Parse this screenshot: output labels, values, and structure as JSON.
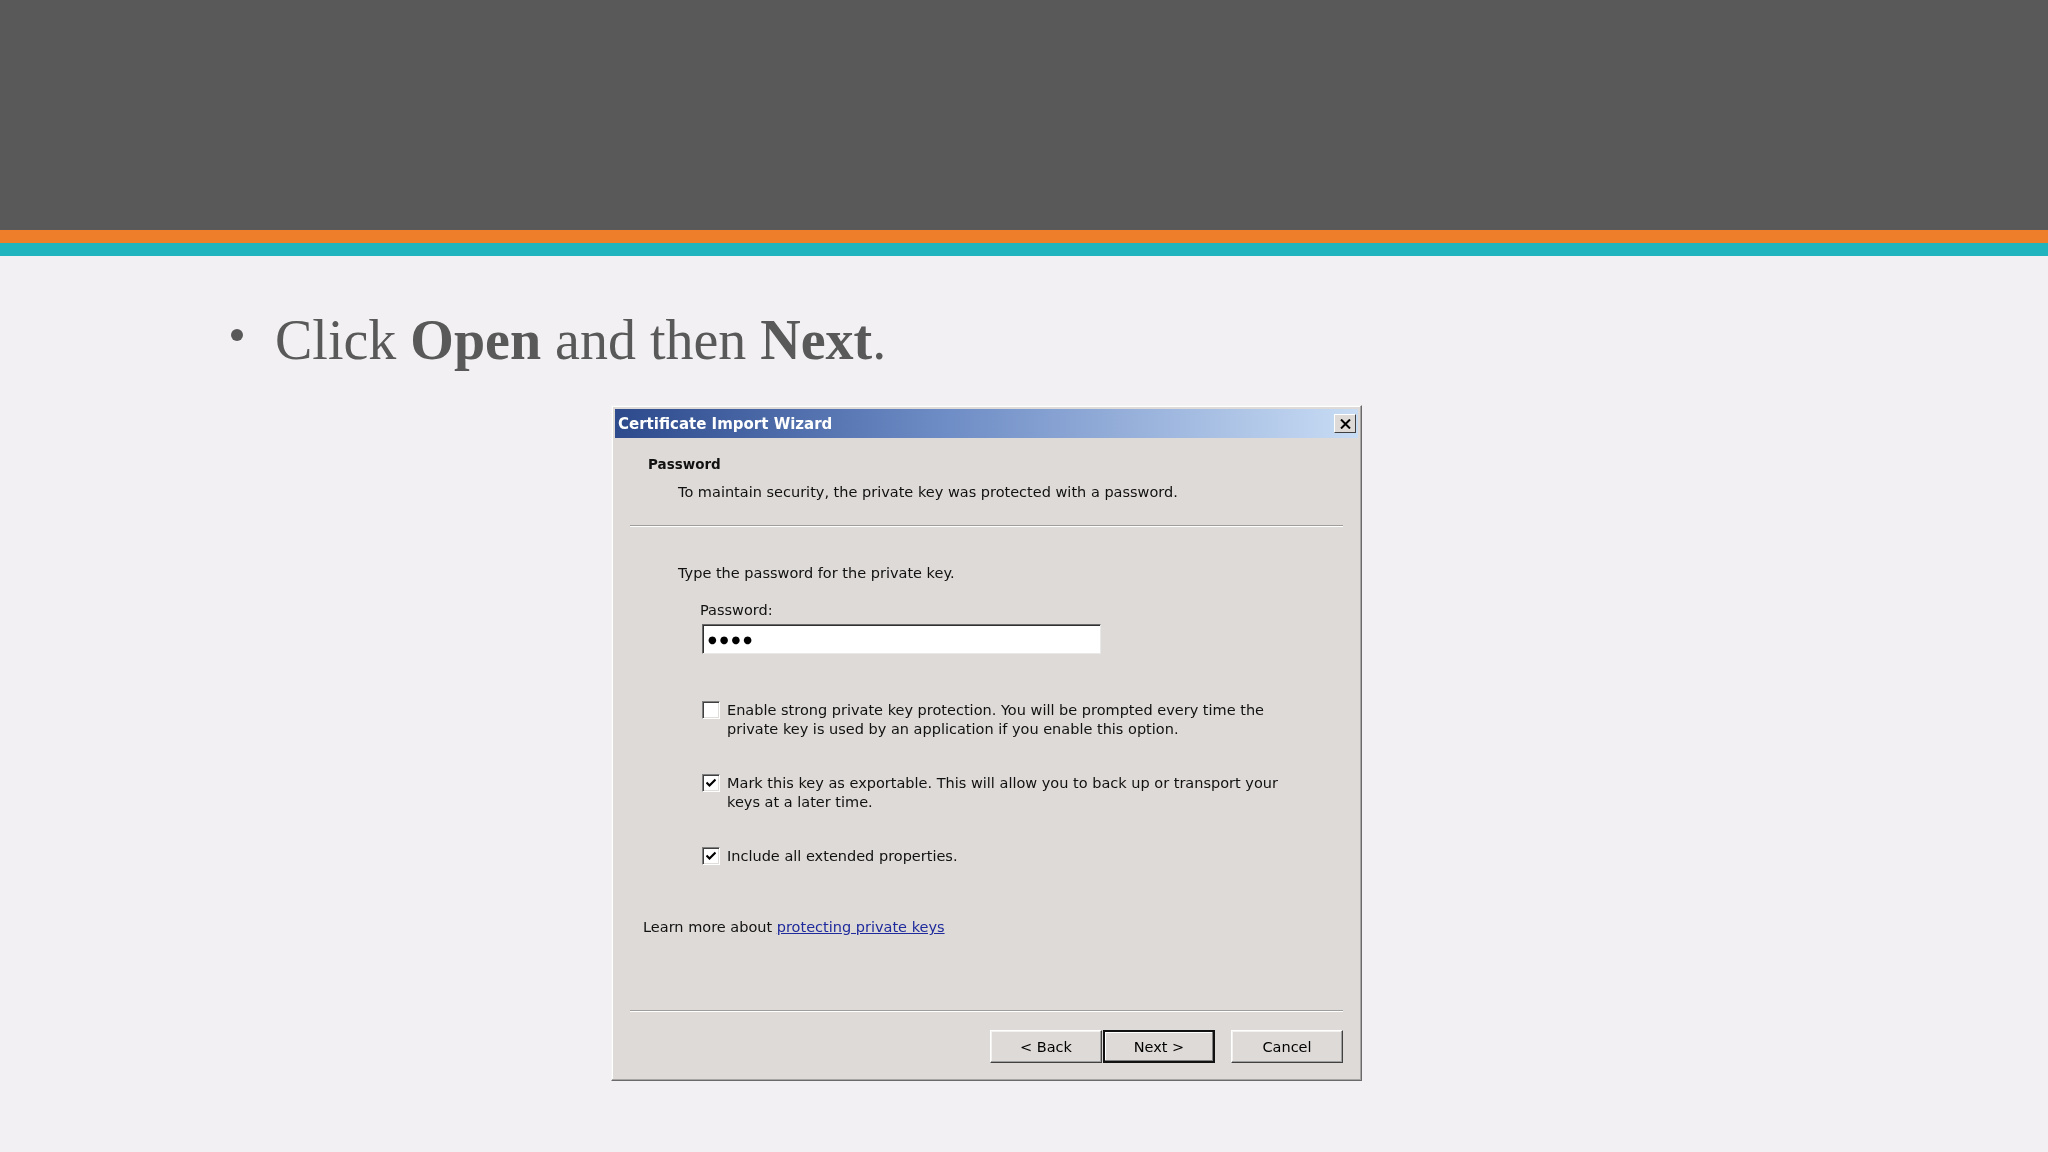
{
  "slide": {
    "bullets": [
      {
        "text": "Click **Open** and then **Next**."
      }
    ]
  },
  "dialog": {
    "title": "Certificate Import Wizard",
    "heading": "Password",
    "description": "To maintain security, the private key was protected with a password.",
    "prompt": "Type the password for the private key.",
    "password_field": {
      "label": "Password:",
      "value": "●●●●"
    },
    "options": [
      {
        "label": "Enable strong private key protection. You will be prompted every time the private key is used by an application if you enable this option.",
        "checked": false
      },
      {
        "label": "Mark this key as exportable. This will allow you to back up or transport your keys at a later time.",
        "checked": true
      },
      {
        "label": "Include all extended properties.",
        "checked": true
      }
    ],
    "help": {
      "text": "Learn more about",
      "link": "protecting private keys"
    },
    "buttons": [
      {
        "label": "< Back",
        "default": false
      },
      {
        "label": "Next >",
        "default": true
      },
      {
        "label": "Cancel",
        "default": false
      }
    ]
  }
}
